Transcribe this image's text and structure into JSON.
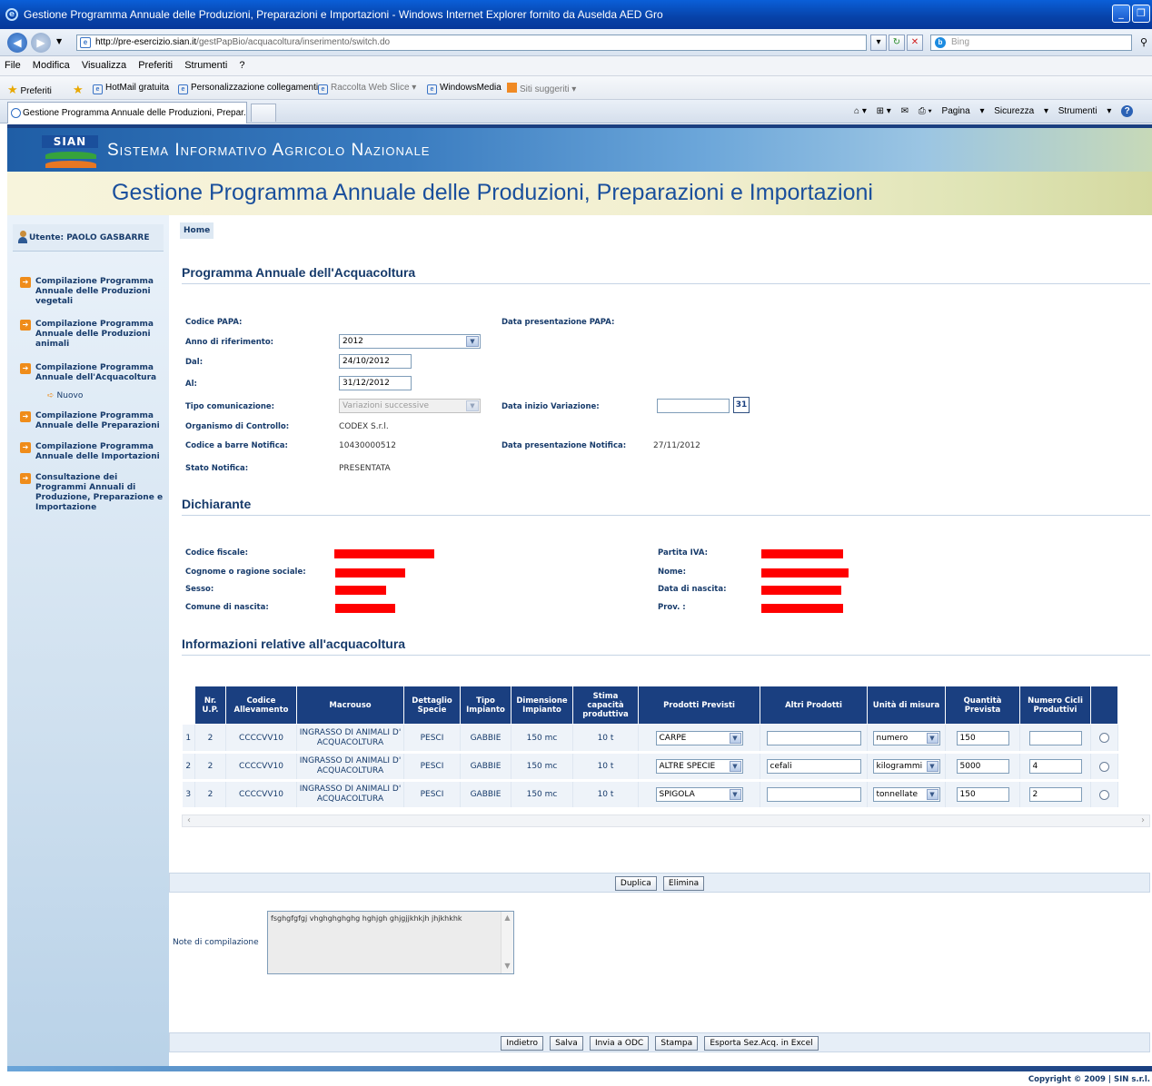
{
  "window": {
    "title": "Gestione Programma Annuale delle Produzioni, Preparazioni e Importazioni - Windows Internet Explorer fornito da Auselda AED Gro"
  },
  "browser": {
    "url_host": "http://pre-esercizio.sian.it",
    "url_path": "/gestPapBio/acquacoltura/inserimento/switch.do",
    "search_placeholder": "Bing",
    "menu": [
      "File",
      "Modifica",
      "Visualizza",
      "Preferiti",
      "Strumenti",
      "?"
    ],
    "favorites": {
      "label": "Preferiti",
      "items": [
        "HotMail gratuita",
        "Personalizzazione collegamenti",
        "Raccolta Web Slice",
        "WindowsMedia",
        "Siti suggeriti"
      ]
    },
    "tab_title": "Gestione Programma Annuale delle Produzioni, Prepar...",
    "command_bar": [
      "Pagina",
      "Sicurezza",
      "Strumenti"
    ]
  },
  "banner": {
    "logo_text": "SIAN",
    "system_name": "Sistema Informativo Agricolo Nazionale",
    "app_title": "Gestione Programma Annuale delle Produzioni, Preparazioni e Importazioni"
  },
  "sidebar": {
    "user": "Utente: PAOLO GASBARRE",
    "items": [
      "Compilazione Programma Annuale delle Produzioni vegetali",
      "Compilazione Programma Annuale delle Produzioni animali",
      "Compilazione Programma Annuale dell'Acquacoltura",
      "Compilazione Programma Annuale delle Preparazioni",
      "Compilazione Programma Annuale delle Importazioni",
      "Consultazione dei Programmi Annuali di Produzione, Preparazione e Importazione"
    ],
    "subitem": "Nuovo"
  },
  "breadcrumb": "Home",
  "programma": {
    "title": "Programma Annuale dell'Acquacoltura",
    "codice_papa_label": "Codice PAPA:",
    "data_presentazione_papa_label": "Data presentazione PAPA:",
    "anno_label": "Anno di riferimento:",
    "anno_value": "2012",
    "dal_label": "Dal:",
    "dal_value": "24/10/2012",
    "al_label": "Al:",
    "al_value": "31/12/2012",
    "tipo_label": "Tipo comunicazione:",
    "tipo_value": "Variazioni successive",
    "data_inizio_label": "Data inizio Variazione:",
    "calendar_day": "31",
    "organismo_label": "Organismo di Controllo:",
    "organismo_value": "CODEX S.r.l.",
    "codice_barre_label": "Codice a barre Notifica:",
    "codice_barre_value": "10430000512",
    "data_notifica_label": "Data presentazione Notifica:",
    "data_notifica_value": "27/11/2012",
    "stato_label": "Stato Notifica:",
    "stato_value": "PRESENTATA"
  },
  "dichiarante": {
    "title": "Dichiarante",
    "codice_fiscale_label": "Codice fiscale:",
    "cognome_label": "Cognome o ragione sociale:",
    "sesso_label": "Sesso:",
    "comune_label": "Comune di nascita:",
    "partita_iva_label": "Partita IVA:",
    "nome_label": "Nome:",
    "data_nascita_label": "Data di nascita:",
    "prov_label": "Prov. :"
  },
  "acquacoltura": {
    "title": "Informazioni relative all'acquacoltura",
    "headers": [
      "Nr. U.P.",
      "Codice Allevamento",
      "Macrouso",
      "Dettaglio Specie",
      "Tipo Impianto",
      "Dimensione Impianto",
      "Stima capacità produttiva",
      "Prodotti Previsti",
      "Altri Prodotti",
      "Unità di misura",
      "Quantità Prevista",
      "Numero Cicli Produttivi"
    ],
    "rows": [
      {
        "idx": "1",
        "nr_up": "2",
        "codice": "CCCCVV10",
        "macrouso": "INGRASSO DI ANIMALI D' ACQUACOLTURA",
        "specie": "PESCI",
        "tipo": "GABBIE",
        "dimensione": "150 mc",
        "stima": "10 t",
        "prodotto": "CARPE",
        "altri": "",
        "unita": "numero",
        "quantita": "150",
        "cicli": ""
      },
      {
        "idx": "2",
        "nr_up": "2",
        "codice": "CCCCVV10",
        "macrouso": "INGRASSO DI ANIMALI D' ACQUACOLTURA",
        "specie": "PESCI",
        "tipo": "GABBIE",
        "dimensione": "150 mc",
        "stima": "10 t",
        "prodotto": "ALTRE SPECIE",
        "altri": "cefali",
        "unita": "kilogrammi",
        "quantita": "5000",
        "cicli": "4"
      },
      {
        "idx": "3",
        "nr_up": "2",
        "codice": "CCCCVV10",
        "macrouso": "INGRASSO DI ANIMALI D' ACQUACOLTURA",
        "specie": "PESCI",
        "tipo": "GABBIE",
        "dimensione": "150 mc",
        "stima": "10 t",
        "prodotto": "SPIGOLA",
        "altri": "",
        "unita": "tonnellate",
        "quantita": "150",
        "cicli": "2"
      }
    ]
  },
  "actions": {
    "duplica": "Duplica",
    "elimina": "Elimina",
    "indietro": "Indietro",
    "salva": "Salva",
    "invia": "Invia a ODC",
    "stampa": "Stampa",
    "esporta": "Esporta Sez.Acq. in Excel"
  },
  "notes": {
    "label": "Note di compilazione",
    "value": "fsghgfgfgj vhghghghghg hghjgh ghjgjjkhkjh jhjkhkhk"
  },
  "footer": {
    "copyright": "Copyright © 2009 | SIN s.r.l."
  },
  "colors": {
    "header_blue": "#1a3f80",
    "title_blue": "#173b6b",
    "accent_orange": "#ef8c1a",
    "redaction": "#ff0000"
  }
}
